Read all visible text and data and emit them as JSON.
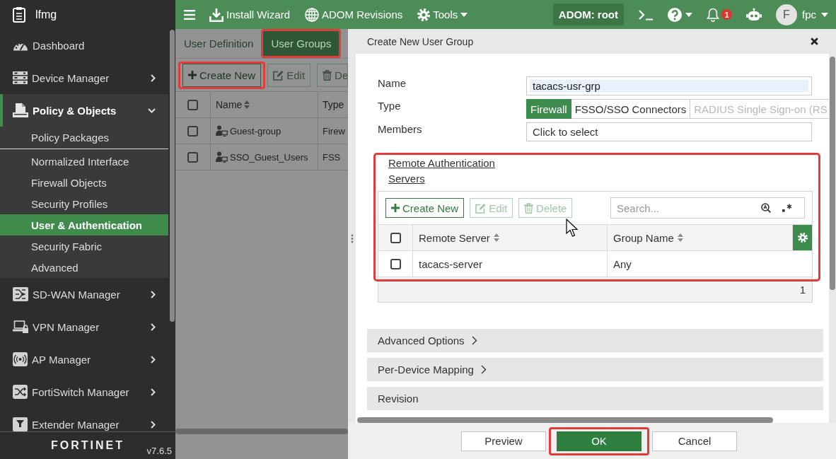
{
  "sidebar": {
    "title": "lfmg",
    "items": [
      {
        "label": "Dashboard",
        "has_submenu": false,
        "expanded": false,
        "active": false
      },
      {
        "label": "Device Manager",
        "has_submenu": true,
        "expanded": false,
        "active": false
      },
      {
        "label": "Policy & Objects",
        "has_submenu": true,
        "expanded": true,
        "active": true,
        "children": [
          {
            "label": "Policy Packages",
            "selected": false,
            "divider_after": true
          },
          {
            "label": "Normalized Interface",
            "selected": false,
            "divider_after": false
          },
          {
            "label": "Firewall Objects",
            "selected": false,
            "divider_after": false
          },
          {
            "label": "Security Profiles",
            "selected": false,
            "divider_after": false
          },
          {
            "label": "User & Authentication",
            "selected": true,
            "divider_after": false
          },
          {
            "label": "Security Fabric",
            "selected": false,
            "divider_after": false
          },
          {
            "label": "Advanced",
            "selected": false,
            "divider_after": false
          }
        ]
      },
      {
        "label": "SD-WAN Manager",
        "has_submenu": true,
        "expanded": false,
        "active": false
      },
      {
        "label": "VPN Manager",
        "has_submenu": true,
        "expanded": false,
        "active": false
      },
      {
        "label": "AP Manager",
        "has_submenu": true,
        "expanded": false,
        "active": false
      },
      {
        "label": "FortiSwitch Manager",
        "has_submenu": true,
        "expanded": false,
        "active": false
      },
      {
        "label": "Extender Manager",
        "has_submenu": true,
        "expanded": false,
        "active": false
      }
    ],
    "logo": "FORTINET",
    "version": "v7.6.5"
  },
  "top_bar": {
    "actions": [
      {
        "label": "Install Wizard",
        "dropdown": false
      },
      {
        "label": "ADOM Revisions",
        "dropdown": false
      },
      {
        "label": "Tools",
        "dropdown": true
      }
    ],
    "adom": "ADOM: root",
    "notification_count": "1",
    "user": {
      "initial": "F",
      "name": "fpc"
    }
  },
  "page": {
    "tabs": [
      {
        "label": "User Definition",
        "selected": false,
        "highlighted": false
      },
      {
        "label": "User Groups",
        "selected": true,
        "highlighted": true
      }
    ],
    "toolbar": [
      {
        "kind": "create",
        "label": "Create New",
        "disabled": false,
        "highlighted": true
      },
      {
        "kind": "edit",
        "label": "Edit",
        "disabled": true,
        "highlighted": false
      },
      {
        "kind": "delete",
        "label": "De",
        "disabled": true,
        "highlighted": false
      }
    ],
    "table": {
      "select_all": false,
      "columns": [
        {
          "label": "Name",
          "sortable": true
        },
        {
          "label": "Type",
          "sortable": false
        }
      ],
      "rows": [
        {
          "checked": false,
          "name": "Guest-group",
          "type": "Firew"
        },
        {
          "checked": false,
          "name": "SSO_Guest_Users",
          "type": "FSS"
        }
      ]
    }
  },
  "dialog": {
    "title": "Create New User Group",
    "fields": [
      {
        "kind": "text",
        "label": "Name",
        "value": "tacacs-usr-grp"
      },
      {
        "kind": "segmented",
        "label": "Type",
        "options": [
          {
            "label": "Firewall",
            "selected": true,
            "disabled": false
          },
          {
            "label": "FSSO/SSO Connectors",
            "selected": false,
            "disabled": false
          },
          {
            "label": "RADIUS Single Sign-on (RS",
            "selected": false,
            "disabled": true
          }
        ]
      },
      {
        "kind": "picker",
        "label": "Members",
        "placeholder": "Click to select"
      }
    ],
    "remote_auth": {
      "title": "Remote Authentication Servers",
      "highlighted": true,
      "toolbar": [
        {
          "kind": "create",
          "label": "Create New",
          "disabled": false
        },
        {
          "kind": "edit",
          "label": "Edit",
          "disabled": true
        },
        {
          "kind": "delete",
          "label": "Delete",
          "disabled": true
        }
      ],
      "search": {
        "placeholder": "Search..."
      },
      "select_all": false,
      "columns": [
        {
          "label": "Remote Server",
          "sortable": true
        },
        {
          "label": "Group Name",
          "sortable": true
        }
      ],
      "rows": [
        {
          "checked": false,
          "remote_server": "tacacs-server",
          "group_name": "Any"
        }
      ],
      "count": "1"
    },
    "sections": [
      {
        "label": "Advanced Options",
        "expandable": true
      },
      {
        "label": "Per-Device Mapping",
        "expandable": true
      },
      {
        "label": "Revision",
        "expandable": false
      }
    ],
    "buttons": [
      {
        "kind": "secondary",
        "label": "Preview",
        "highlighted": false
      },
      {
        "kind": "primary",
        "label": "OK",
        "highlighted": true
      },
      {
        "kind": "secondary",
        "label": "Cancel",
        "highlighted": false
      }
    ]
  }
}
